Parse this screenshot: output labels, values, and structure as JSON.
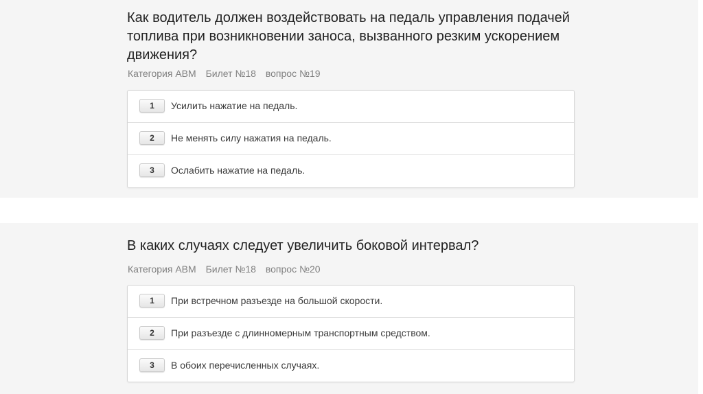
{
  "questions": [
    {
      "title": "Как водитель должен воздействовать на педаль управления подачей топлива при возникновении заноса, вызванного резким ускорением движения?",
      "category": "Категория ABM",
      "ticket": "Билет №18",
      "question_no": "вопрос №19",
      "answers": [
        {
          "num": "1",
          "text": "Усилить нажатие на педаль."
        },
        {
          "num": "2",
          "text": "Не менять силу нажатия на педаль."
        },
        {
          "num": "3",
          "text": "Ослабить нажатие на педаль."
        }
      ]
    },
    {
      "title": "В каких случаях следует увеличить боковой интервал?",
      "category": "Категория ABM",
      "ticket": "Билет №18",
      "question_no": "вопрос №20",
      "answers": [
        {
          "num": "1",
          "text": "При встречном разъезде на большой скорости."
        },
        {
          "num": "2",
          "text": "При разъезде с длинномерным транспортным средством."
        },
        {
          "num": "3",
          "text": "В обоих перечисленных случаях."
        }
      ]
    }
  ]
}
